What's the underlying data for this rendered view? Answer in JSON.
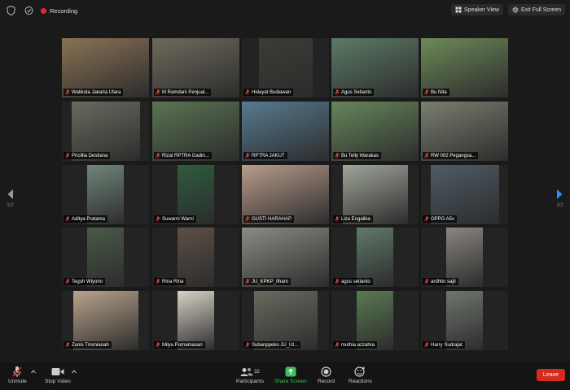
{
  "topbar": {
    "recording_label": "Recording",
    "speaker_view_label": "Speaker View",
    "exit_fullscreen_label": "Exit Full Screen",
    "icons": [
      "shield-icon",
      "lock-icon",
      "record-icon"
    ]
  },
  "pagination": {
    "left_label": "1/2",
    "right_label": "1/2",
    "right_arrow_color": "#2d8cff"
  },
  "participants": [
    {
      "name": "Walikota Jakarta Utara",
      "active": true
    },
    {
      "name": "M Ramdani Penjual..."
    },
    {
      "name": "Hidayat Budiawan"
    },
    {
      "name": "Agus Setianto"
    },
    {
      "name": "Bu Nita"
    },
    {
      "name": "Pricillia Destiana"
    },
    {
      "name": "Rizal RPTRA Gadin..."
    },
    {
      "name": "RPTRA JAKUT"
    },
    {
      "name": "Bu Telly Warakas"
    },
    {
      "name": "RW 002 Pegangsa..."
    },
    {
      "name": "Aditya Pratama"
    },
    {
      "name": "Suwarni Warni"
    },
    {
      "name": "GUSTI HARAHAP"
    },
    {
      "name": "Liza Engalika"
    },
    {
      "name": "OPPO A5s"
    },
    {
      "name": "Teguh Wiyono"
    },
    {
      "name": "Rina Rina"
    },
    {
      "name": "JU_KPKP_Ilham"
    },
    {
      "name": "agus setianto"
    },
    {
      "name": "ardhito sajti"
    },
    {
      "name": "Zunis Trismianah"
    },
    {
      "name": "Milya Purnamasari"
    },
    {
      "name": "Subanppeko JU_Ut..."
    },
    {
      "name": "muthia azzahra"
    },
    {
      "name": "Harry Sudrajat"
    }
  ],
  "toolbar": {
    "unmute_label": "Unmute",
    "stop_video_label": "Stop Video",
    "participants_label": "Participants",
    "participants_count": "32",
    "share_screen_label": "Share Screen",
    "record_label": "Record",
    "reactions_label": "Reactions",
    "leave_label": "Leave",
    "share_color": "#3fbf5a",
    "leave_color": "#d52b1e"
  }
}
